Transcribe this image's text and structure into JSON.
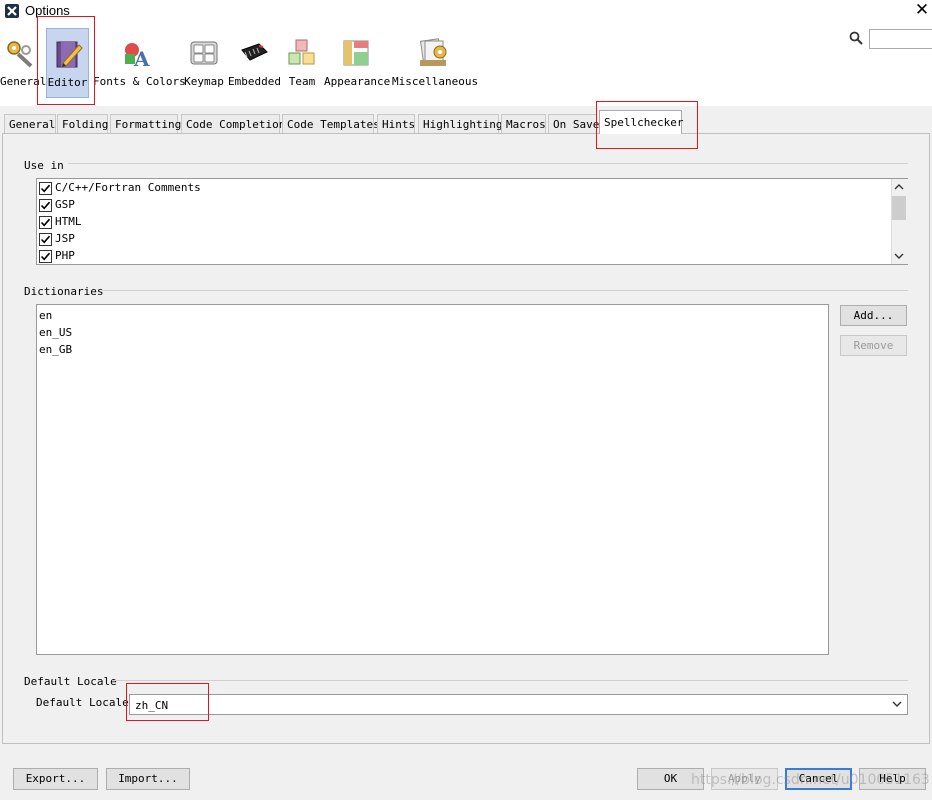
{
  "window": {
    "title": "Options",
    "close_glyph": "✕"
  },
  "categories": [
    {
      "label": "General",
      "icon": "gears-wrench-icon"
    },
    {
      "label": "Editor",
      "icon": "pencil-notebook-icon",
      "selected": true
    },
    {
      "label": "Fonts & Colors",
      "icon": "shapes-letter-a-icon"
    },
    {
      "label": "Keymap",
      "icon": "keyboard-icon"
    },
    {
      "label": "Embedded",
      "icon": "microchip-icon"
    },
    {
      "label": "Team",
      "icon": "cubes-icon"
    },
    {
      "label": "Appearance",
      "icon": "layout-panels-icon"
    },
    {
      "label": "Miscellaneous",
      "icon": "folder-gear-icon"
    }
  ],
  "search": {
    "value": ""
  },
  "tabs": [
    {
      "label": "General"
    },
    {
      "label": "Folding"
    },
    {
      "label": "Formatting"
    },
    {
      "label": "Code Completion"
    },
    {
      "label": "Code Templates"
    },
    {
      "label": "Hints"
    },
    {
      "label": "Highlighting"
    },
    {
      "label": "Macros"
    },
    {
      "label": "On Save"
    },
    {
      "label": "Spellchecker",
      "selected": true
    }
  ],
  "use_in": {
    "title": "Use in",
    "items": [
      {
        "label": "C/C++/Fortran Comments",
        "checked": true
      },
      {
        "label": "GSP",
        "checked": true
      },
      {
        "label": "HTML",
        "checked": true
      },
      {
        "label": "JSP",
        "checked": true
      },
      {
        "label": "PHP",
        "checked": true
      }
    ]
  },
  "dictionaries": {
    "title": "Dictionaries",
    "items": [
      "en",
      "en_US",
      "en_GB"
    ],
    "add_label": "Add...",
    "remove_label": "Remove"
  },
  "default_locale": {
    "title": "Default Locale",
    "label": "Default Locale:",
    "value": "zh_CN"
  },
  "footer": {
    "export_label": "Export...",
    "import_label": "Import...",
    "ok_label": "OK",
    "apply_label": "Apply",
    "cancel_label": "Cancel",
    "help_label": "Help"
  },
  "watermark": "https://blog.csdn.net/u010051163",
  "colors": {
    "selection": "#c7d6ee",
    "annotation_red": "#e0161c"
  }
}
